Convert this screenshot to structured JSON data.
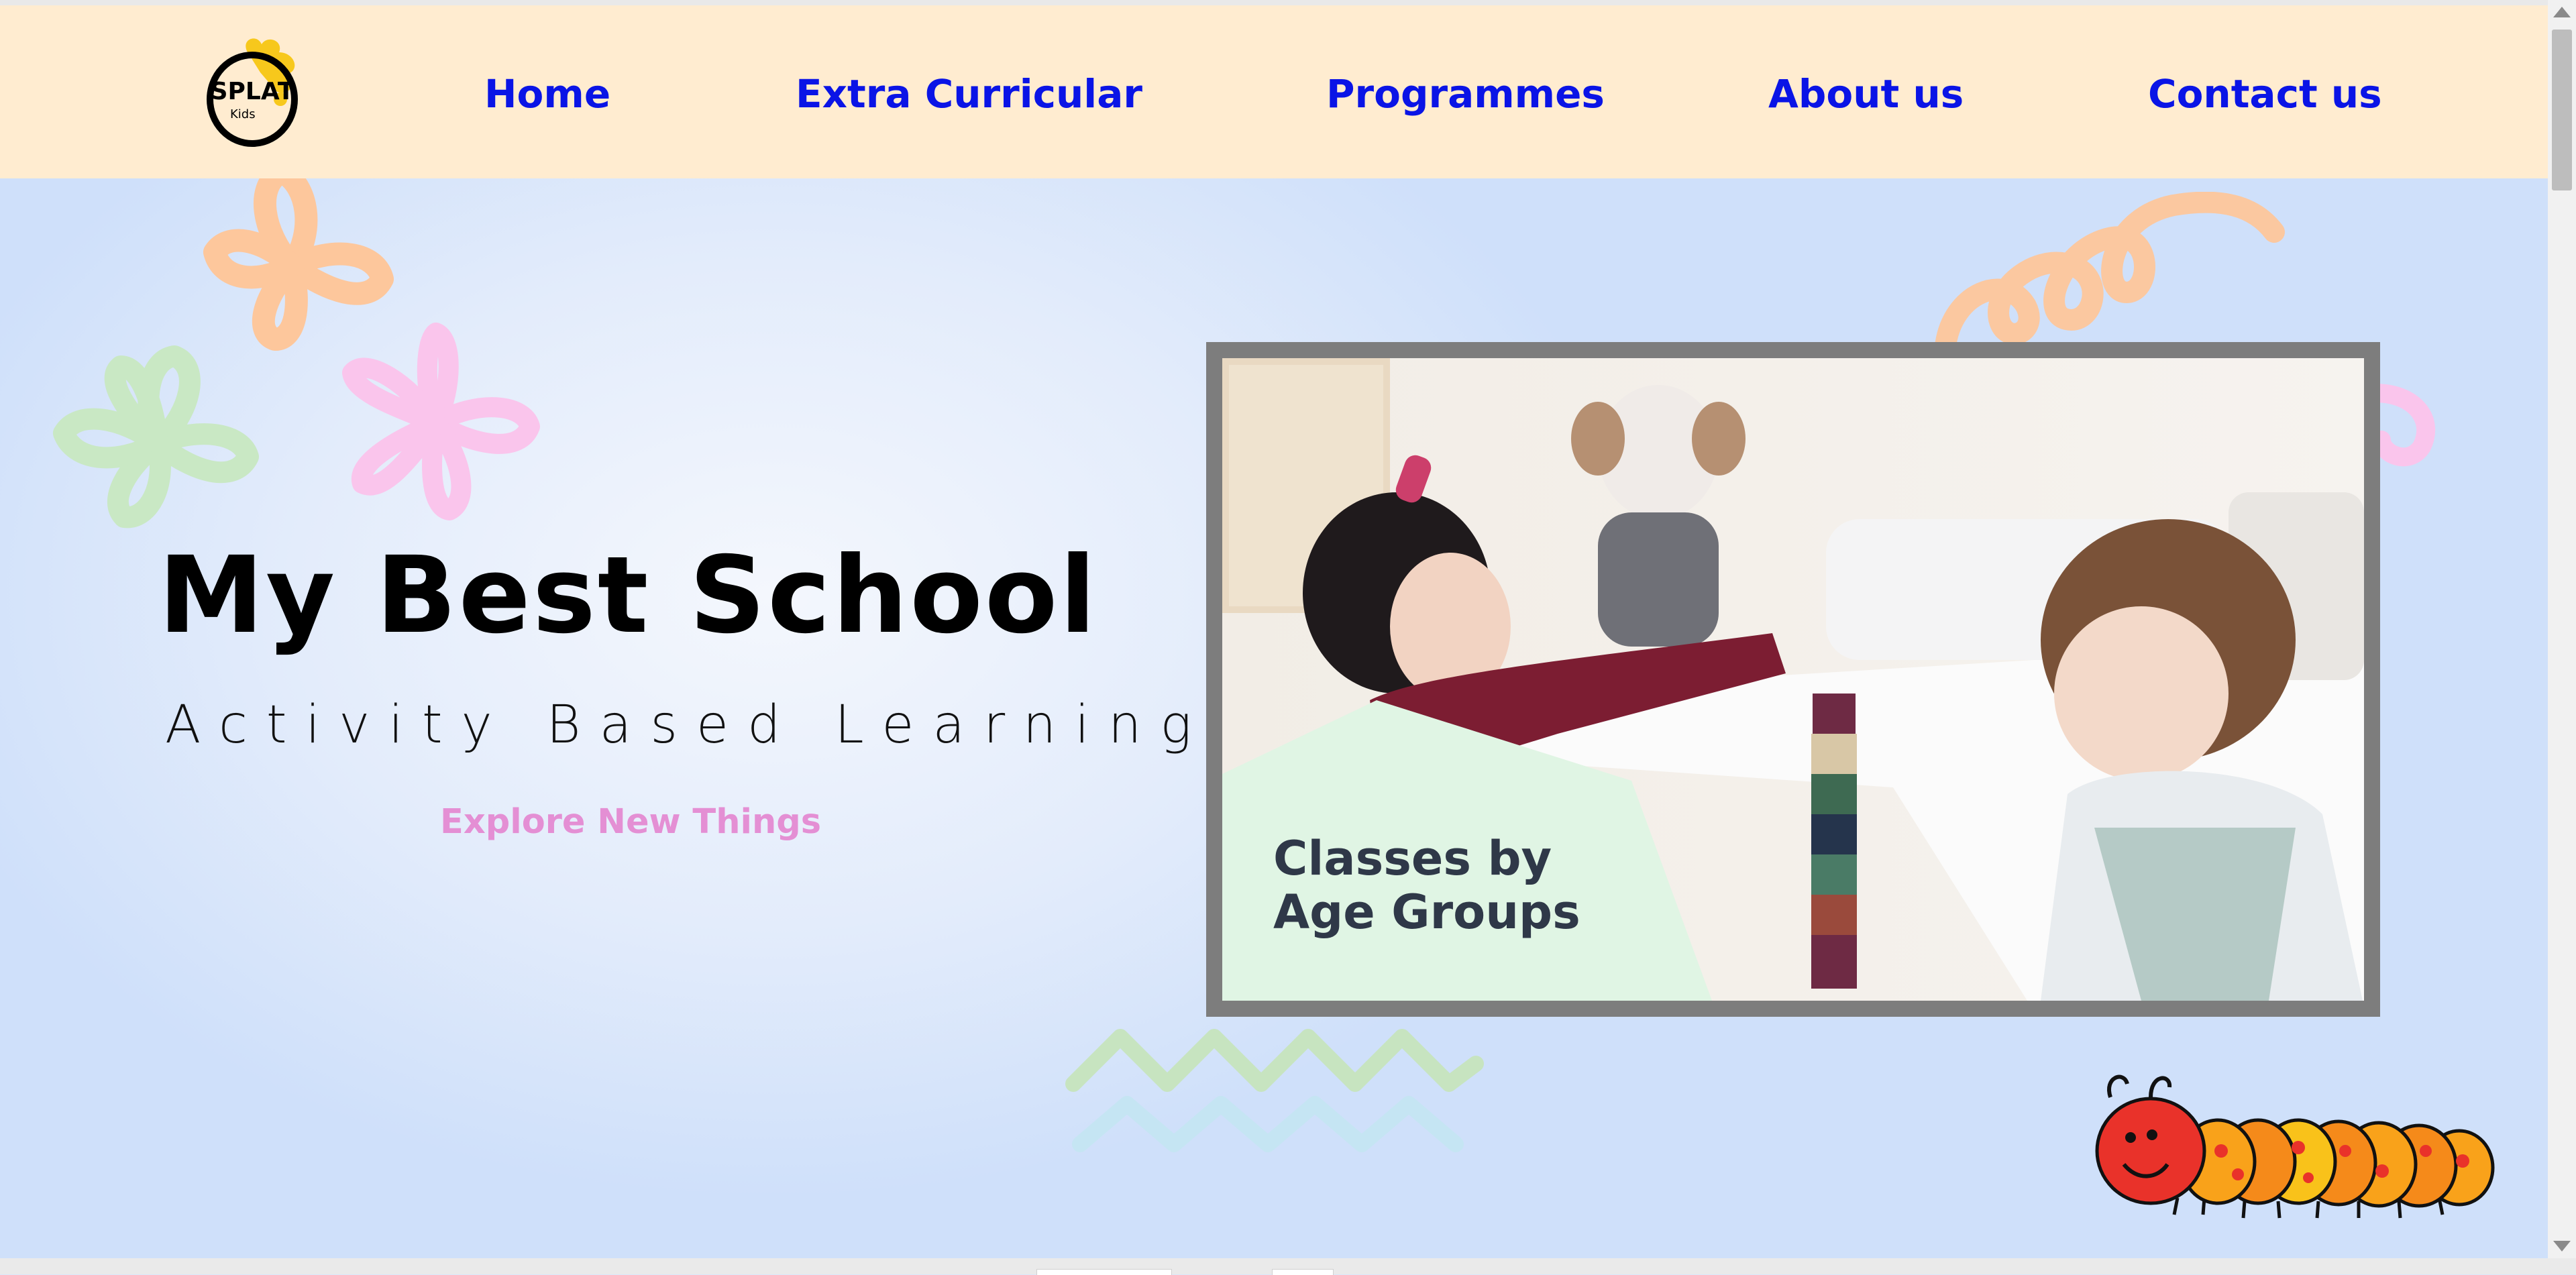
{
  "logo": {
    "text": "SPLAT",
    "subtext": "Kids"
  },
  "nav": {
    "items": [
      {
        "label": "Home"
      },
      {
        "label": "Extra Curricular"
      },
      {
        "label": "Programmes"
      },
      {
        "label": "About us"
      },
      {
        "label": "Contact us"
      }
    ]
  },
  "hero": {
    "title": "My Best School",
    "subtitle": "Activity Based Learning",
    "cta": "Explore New Things",
    "video": {
      "caption_line1": "Classes by",
      "caption_line2": "Age Groups"
    }
  },
  "colors": {
    "navbar_bg": "#ffecd0",
    "nav_link": "#0a14e6",
    "cta": "#e48fd4",
    "hero_bg": "#dbe7fb",
    "video_frame": "#7d7d7d",
    "caption_panel": "#e0f5e4"
  },
  "icons": [
    "splat-logo-icon",
    "flower-icon",
    "curl-squiggle-icon",
    "zigzag-icon",
    "caterpillar-icon"
  ]
}
